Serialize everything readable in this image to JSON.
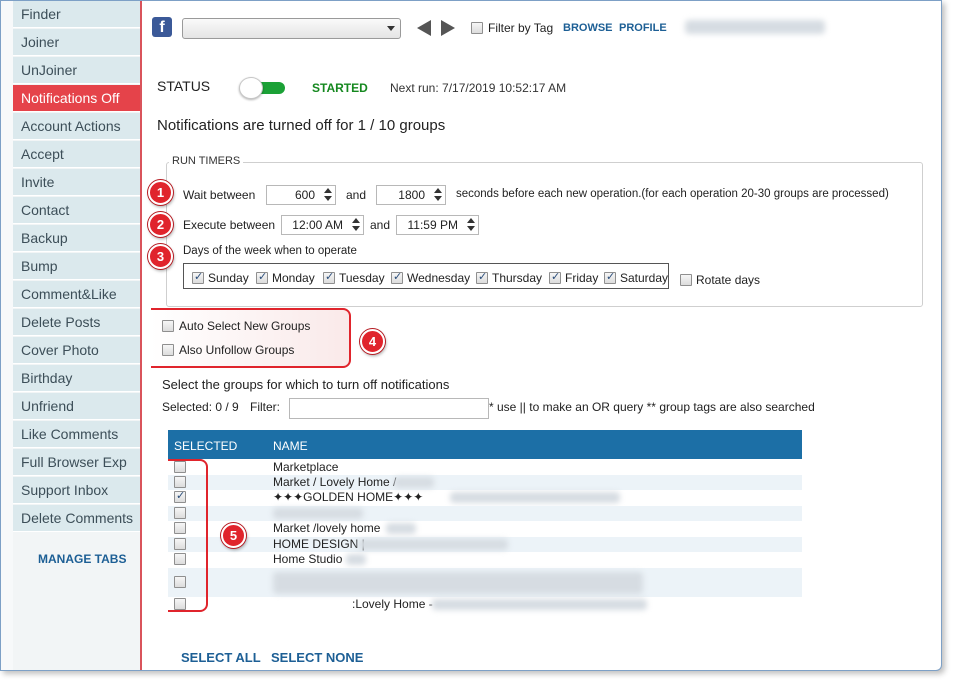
{
  "sidebar": {
    "items": [
      {
        "label": "Finder",
        "active": false
      },
      {
        "label": "Joiner",
        "active": false
      },
      {
        "label": "UnJoiner",
        "active": false
      },
      {
        "label": "Notifications Off",
        "active": true
      },
      {
        "label": "Account Actions",
        "active": false
      },
      {
        "label": "Accept",
        "active": false
      },
      {
        "label": "Invite",
        "active": false
      },
      {
        "label": "Contact",
        "active": false
      },
      {
        "label": "Backup",
        "active": false
      },
      {
        "label": "Bump",
        "active": false
      },
      {
        "label": "Comment&Like",
        "active": false
      },
      {
        "label": "Delete Posts",
        "active": false
      },
      {
        "label": "Cover Photo",
        "active": false
      },
      {
        "label": "Birthday",
        "active": false
      },
      {
        "label": "Unfriend",
        "active": false
      },
      {
        "label": "Like Comments",
        "active": false
      },
      {
        "label": "Full Browser Exp",
        "active": false
      },
      {
        "label": "Support Inbox",
        "active": false
      },
      {
        "label": "Delete Comments",
        "active": false
      }
    ],
    "manage_tabs": "MANAGE TABS"
  },
  "topbar": {
    "facebook_icon": "f",
    "account_value": "",
    "filter_by_tag": "Filter by Tag",
    "browse": "BROWSE",
    "profile": "PROFILE"
  },
  "status": {
    "label": "STATUS",
    "toggle_on": true,
    "state": "STARTED",
    "next_run": "Next run: 7/17/2019 10:52:17 AM",
    "summary": "Notifications are turned off for 1 / 10 groups"
  },
  "timers": {
    "legend": "RUN TIMERS",
    "wait_label": "Wait between",
    "wait_min": "600",
    "and": "and",
    "wait_max": "1800",
    "wait_suffix": "seconds before each new operation.(for each operation 20-30 groups are processed)",
    "execute_label": "Execute between",
    "execute_start": "12:00 AM",
    "execute_end": "11:59 PM",
    "days_label": "Days of the week when to operate",
    "days": [
      {
        "label": "Sunday",
        "checked": true
      },
      {
        "label": "Monday",
        "checked": true
      },
      {
        "label": "Tuesday",
        "checked": true
      },
      {
        "label": "Wednesday",
        "checked": true
      },
      {
        "label": "Thursday",
        "checked": true
      },
      {
        "label": "Friday",
        "checked": true
      },
      {
        "label": "Saturday",
        "checked": true
      }
    ],
    "rotate_days": "Rotate days"
  },
  "badges": [
    "1",
    "2",
    "3",
    "4",
    "5"
  ],
  "options": {
    "auto_select": "Auto Select New Groups",
    "also_unfollow": "Also Unfollow Groups"
  },
  "groups": {
    "heading": "Select the groups for which to turn off notifications",
    "selected_text": "Selected:  0 / 9",
    "filter_label": "Filter:",
    "filter_value": "",
    "filter_hint": "* use || to make an OR query ** group tags are also searched",
    "col_selected": "SELECTED",
    "col_name": "NAME",
    "rows": [
      {
        "name": "Marketplace",
        "checked": false
      },
      {
        "name": "Market / Lovely Home /",
        "checked": false
      },
      {
        "name": "✦✦✦GOLDEN HOME✦✦✦",
        "checked": true
      },
      {
        "name": "",
        "checked": false
      },
      {
        "name": "Market /lovely  home",
        "checked": false
      },
      {
        "name": "HOME DESIGN |",
        "checked": false
      },
      {
        "name": "Home Studio",
        "checked": false
      },
      {
        "name": "",
        "checked": false
      },
      {
        "name": ":Lovely Home -",
        "checked": false
      }
    ],
    "select_all": "SELECT ALL",
    "select_none": "SELECT NONE"
  },
  "colors": {
    "accent_red": "#e5434a",
    "link_blue": "#1d5f95",
    "header_blue": "#1c6fa6",
    "started_green": "#15881f"
  }
}
